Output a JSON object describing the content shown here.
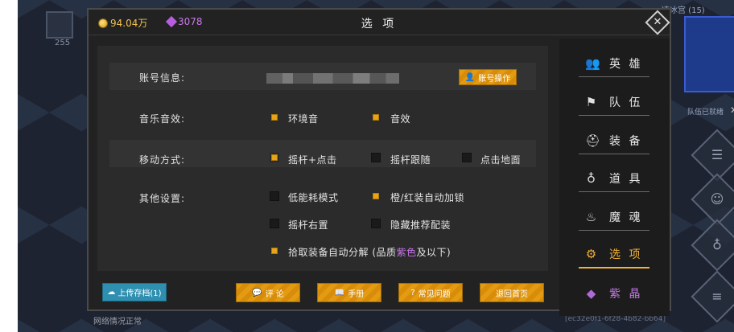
{
  "background": {
    "left_slot_count": "255",
    "map_title": "凌冰宫 (15)",
    "ready_text": "队伍已就绪",
    "network_status": "网络情况正常",
    "uuid": "[ec32e0f1-6f28-4b82-bb64]"
  },
  "header": {
    "gold": "94.04万",
    "gems": "3078",
    "title": "选 项"
  },
  "settings": {
    "account": {
      "label": "账号信息:",
      "button": "账号操作"
    },
    "sound": {
      "label": "音乐音效:",
      "options": [
        {
          "text": "环境音",
          "checked": true
        },
        {
          "text": "音效",
          "checked": true
        }
      ]
    },
    "move": {
      "label": "移动方式:",
      "options": [
        {
          "text": "摇杆+点击",
          "checked": true
        },
        {
          "text": "摇杆跟随",
          "checked": false
        },
        {
          "text": "点击地面",
          "checked": false
        }
      ]
    },
    "other": {
      "label": "其他设置:",
      "options": [
        {
          "text": "低能耗模式",
          "checked": false
        },
        {
          "text": "橙/红装自动加锁",
          "checked": true
        },
        {
          "text": "摇杆右置",
          "checked": false
        },
        {
          "text": "隐藏推荐配装",
          "checked": false
        }
      ],
      "auto_decompose": {
        "prefix": "拾取装备自动分解 (品质",
        "highlight": "紫色",
        "suffix": "及以下)",
        "checked": true
      }
    }
  },
  "buttons": {
    "upload": "上传存档(1)",
    "comment": "评 论",
    "manual": "手册",
    "faq": "常见问题",
    "home": "退回首页"
  },
  "side_menu": [
    {
      "label": "英 雄",
      "icon": "heroes-icon"
    },
    {
      "label": "队 伍",
      "icon": "flag-icon"
    },
    {
      "label": "装 备",
      "icon": "helmet-icon"
    },
    {
      "label": "道 具",
      "icon": "bag-icon"
    },
    {
      "label": "魔 魂",
      "icon": "flame-icon"
    },
    {
      "label": "选 项",
      "icon": "gear-icon",
      "active": true
    },
    {
      "label": "紫 晶",
      "icon": "crystal-icon"
    }
  ]
}
